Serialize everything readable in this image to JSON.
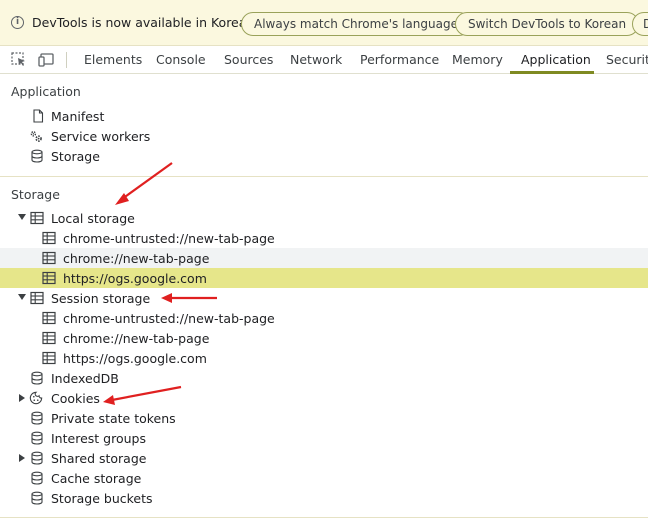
{
  "infobar": {
    "message": "DevTools is now available in Korean!",
    "match_button": "Always match Chrome's language",
    "switch_button": "Switch DevTools to Korean",
    "more_button": "D"
  },
  "tabs": [
    "Elements",
    "Console",
    "Sources",
    "Network",
    "Performance",
    "Memory",
    "Application",
    "Security"
  ],
  "active_tab": "Application",
  "application_section": {
    "title": "Application",
    "items": [
      "Manifest",
      "Service workers",
      "Storage"
    ]
  },
  "storage_section": {
    "title": "Storage",
    "local_storage": {
      "label": "Local storage",
      "children": [
        "chrome-untrusted://new-tab-page",
        "chrome://new-tab-page",
        "https://ogs.google.com"
      ]
    },
    "session_storage": {
      "label": "Session storage",
      "children": [
        "chrome-untrusted://new-tab-page",
        "chrome://new-tab-page",
        "https://ogs.google.com"
      ]
    },
    "others": [
      "IndexedDB",
      "Cookies",
      "Private state tokens",
      "Interest groups",
      "Shared storage",
      "Cache storage",
      "Storage buckets"
    ]
  },
  "colors": {
    "selected_row": "#e6e68a",
    "accent": "#7f8a22",
    "annotation_arrow": "#e02020"
  }
}
